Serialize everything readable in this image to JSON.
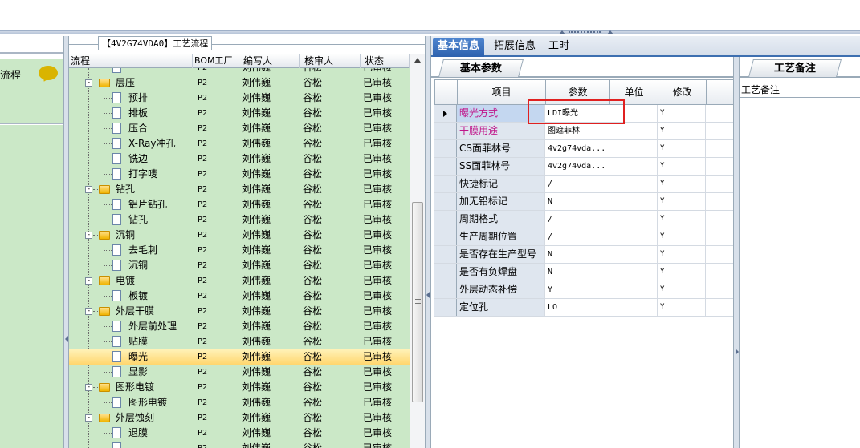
{
  "left_panel": {
    "item_label": "流程"
  },
  "tree_panel": {
    "title": "【4V2G74VDA0】工艺流程",
    "columns": [
      "流程",
      "BOM工厂",
      "编写人",
      "核审人",
      "状态"
    ],
    "rows": [
      {
        "name": "",
        "bom": "P2",
        "writer": "刘伟巍",
        "reviewer": "谷松",
        "status": "已审核",
        "level": 2,
        "kind": "doc"
      },
      {
        "name": "层压",
        "bom": "P2",
        "writer": "刘伟巍",
        "reviewer": "谷松",
        "status": "已审核",
        "level": 1,
        "kind": "folder"
      },
      {
        "name": "预排",
        "bom": "P2",
        "writer": "刘伟巍",
        "reviewer": "谷松",
        "status": "已审核",
        "level": 2,
        "kind": "doc"
      },
      {
        "name": "排板",
        "bom": "P2",
        "writer": "刘伟巍",
        "reviewer": "谷松",
        "status": "已审核",
        "level": 2,
        "kind": "doc"
      },
      {
        "name": "压合",
        "bom": "P2",
        "writer": "刘伟巍",
        "reviewer": "谷松",
        "status": "已审核",
        "level": 2,
        "kind": "doc"
      },
      {
        "name": "X-Ray冲孔",
        "bom": "P2",
        "writer": "刘伟巍",
        "reviewer": "谷松",
        "status": "已审核",
        "level": 2,
        "kind": "doc"
      },
      {
        "name": "铣边",
        "bom": "P2",
        "writer": "刘伟巍",
        "reviewer": "谷松",
        "status": "已审核",
        "level": 2,
        "kind": "doc"
      },
      {
        "name": "打字唛",
        "bom": "P2",
        "writer": "刘伟巍",
        "reviewer": "谷松",
        "status": "已审核",
        "level": 2,
        "kind": "doc"
      },
      {
        "name": "钻孔",
        "bom": "P2",
        "writer": "刘伟巍",
        "reviewer": "谷松",
        "status": "已审核",
        "level": 1,
        "kind": "folder"
      },
      {
        "name": "铝片钻孔",
        "bom": "P2",
        "writer": "刘伟巍",
        "reviewer": "谷松",
        "status": "已审核",
        "level": 2,
        "kind": "doc"
      },
      {
        "name": "钻孔",
        "bom": "P2",
        "writer": "刘伟巍",
        "reviewer": "谷松",
        "status": "已审核",
        "level": 2,
        "kind": "doc"
      },
      {
        "name": "沉铜",
        "bom": "P2",
        "writer": "刘伟巍",
        "reviewer": "谷松",
        "status": "已审核",
        "level": 1,
        "kind": "folder"
      },
      {
        "name": "去毛刺",
        "bom": "P2",
        "writer": "刘伟巍",
        "reviewer": "谷松",
        "status": "已审核",
        "level": 2,
        "kind": "doc"
      },
      {
        "name": "沉铜",
        "bom": "P2",
        "writer": "刘伟巍",
        "reviewer": "谷松",
        "status": "已审核",
        "level": 2,
        "kind": "doc"
      },
      {
        "name": "电镀",
        "bom": "P2",
        "writer": "刘伟巍",
        "reviewer": "谷松",
        "status": "已审核",
        "level": 1,
        "kind": "folder"
      },
      {
        "name": "板镀",
        "bom": "P2",
        "writer": "刘伟巍",
        "reviewer": "谷松",
        "status": "已审核",
        "level": 2,
        "kind": "doc"
      },
      {
        "name": "外层干膜",
        "bom": "P2",
        "writer": "刘伟巍",
        "reviewer": "谷松",
        "status": "已审核",
        "level": 1,
        "kind": "folder"
      },
      {
        "name": "外层前处理",
        "bom": "P2",
        "writer": "刘伟巍",
        "reviewer": "谷松",
        "status": "已审核",
        "level": 2,
        "kind": "doc"
      },
      {
        "name": "贴膜",
        "bom": "P2",
        "writer": "刘伟巍",
        "reviewer": "谷松",
        "status": "已审核",
        "level": 2,
        "kind": "doc"
      },
      {
        "name": "曝光",
        "bom": "P2",
        "writer": "刘伟巍",
        "reviewer": "谷松",
        "status": "已审核",
        "level": 2,
        "kind": "doc",
        "selected": true
      },
      {
        "name": "显影",
        "bom": "P2",
        "writer": "刘伟巍",
        "reviewer": "谷松",
        "status": "已审核",
        "level": 2,
        "kind": "doc"
      },
      {
        "name": "图形电镀",
        "bom": "P2",
        "writer": "刘伟巍",
        "reviewer": "谷松",
        "status": "已审核",
        "level": 1,
        "kind": "folder"
      },
      {
        "name": "图形电镀",
        "bom": "P2",
        "writer": "刘伟巍",
        "reviewer": "谷松",
        "status": "已审核",
        "level": 2,
        "kind": "doc"
      },
      {
        "name": "外层蚀刻",
        "bom": "P2",
        "writer": "刘伟巍",
        "reviewer": "谷松",
        "status": "已审核",
        "level": 1,
        "kind": "folder"
      },
      {
        "name": "退膜",
        "bom": "P2",
        "writer": "刘伟巍",
        "reviewer": "谷松",
        "status": "已审核",
        "level": 2,
        "kind": "doc"
      },
      {
        "name": "",
        "bom": "P2",
        "writer": "刘伟巍",
        "reviewer": "谷松",
        "status": "已审核",
        "level": 2,
        "kind": "doc"
      }
    ]
  },
  "tabs": [
    "基本信息",
    "拓展信息",
    "工时"
  ],
  "params": {
    "subtab": "基本参数",
    "columns": [
      "项目",
      "参数",
      "单位",
      "修改"
    ],
    "rows": [
      {
        "item": "曝光方式",
        "value": "LDI曝光",
        "unit": "",
        "extra": "",
        "modify": "Y",
        "color": "#c0168a",
        "selected": true
      },
      {
        "item": "干膜用途",
        "value": "图遮菲林",
        "unit": "",
        "extra": "",
        "modify": "Y",
        "color": "#c0168a"
      },
      {
        "item": "CS面菲林号",
        "value": "4v2g74vda...",
        "unit": "",
        "extra": "",
        "modify": "Y",
        "color": "#000000"
      },
      {
        "item": "SS面菲林号",
        "value": "4v2g74vda...",
        "unit": "",
        "extra": "",
        "modify": "Y",
        "color": "#000000"
      },
      {
        "item": "快捷标记",
        "value": "/",
        "unit": "",
        "extra": "",
        "modify": "Y",
        "color": "#000000"
      },
      {
        "item": "加无铅标记",
        "value": "N",
        "unit": "",
        "extra": "",
        "modify": "Y",
        "color": "#000000"
      },
      {
        "item": "周期格式",
        "value": "/",
        "unit": "",
        "extra": "",
        "modify": "Y",
        "color": "#000000"
      },
      {
        "item": "生产周期位置",
        "value": "/",
        "unit": "",
        "extra": "",
        "modify": "Y",
        "color": "#000000"
      },
      {
        "item": "是否存在生产型号",
        "value": "N",
        "unit": "",
        "extra": "",
        "modify": "Y",
        "color": "#000000"
      },
      {
        "item": "是否有负焊盘",
        "value": "N",
        "unit": "",
        "extra": "",
        "modify": "Y",
        "color": "#000000"
      },
      {
        "item": "外层动态补偿",
        "value": "Y",
        "unit": "",
        "extra": "",
        "modify": "Y",
        "color": "#000000"
      },
      {
        "item": "定位孔",
        "value": "LO",
        "unit": "",
        "extra": "",
        "modify": "Y",
        "color": "#000000"
      }
    ]
  },
  "notes": {
    "tab": "工艺备注",
    "label": "工艺备注"
  }
}
